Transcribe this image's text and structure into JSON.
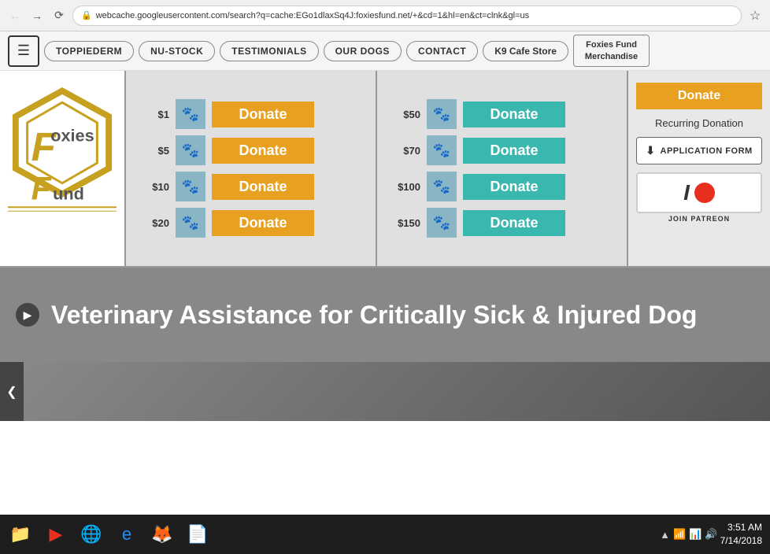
{
  "browser": {
    "url": "webcache.googleusercontent.com/search?q=cache:EGo1dlaxSq4J:foxiesfund.net/+&cd=1&hl=en&ct=clnk&gl=us",
    "lock_icon": "🔒",
    "back_disabled": true,
    "forward_disabled": false
  },
  "nav": {
    "menu_icon": "☰",
    "items": [
      {
        "label": "TOPPIEDERM",
        "id": "toppiederm"
      },
      {
        "label": "NU-STOCK",
        "id": "nu-stock"
      },
      {
        "label": "TESTIMONIALS",
        "id": "testimonials"
      },
      {
        "label": "OUR DOGS",
        "id": "our-dogs"
      },
      {
        "label": "CONTACT",
        "id": "contact"
      },
      {
        "label": "K9 Cafe Store",
        "id": "cafe-store"
      },
      {
        "label": "Foxies Fund Merchandise",
        "id": "merchandise"
      }
    ]
  },
  "donate_left": {
    "rows": [
      {
        "amount": "$1",
        "label": "Donate"
      },
      {
        "amount": "$5",
        "label": "Donate"
      },
      {
        "amount": "$10",
        "label": "Donate"
      },
      {
        "amount": "$20",
        "label": "Donate"
      }
    ]
  },
  "donate_right": {
    "rows": [
      {
        "amount": "$50",
        "label": "Donate"
      },
      {
        "amount": "$70",
        "label": "Donate"
      },
      {
        "amount": "$100",
        "label": "Donate"
      },
      {
        "amount": "$150",
        "label": "Donate"
      }
    ]
  },
  "sidebar": {
    "donate_label": "Donate",
    "recurring_label": "Recurring Donation",
    "app_form_label": "APPLICATION FORM",
    "patreon_label": "JOIN PATREON"
  },
  "banner": {
    "text": "Veterinary Assistance for Critically Sick & Injured Dog"
  },
  "taskbar": {
    "time": "3:51 AM",
    "date": "7/14/2018"
  },
  "paw_emoji": "🐾"
}
